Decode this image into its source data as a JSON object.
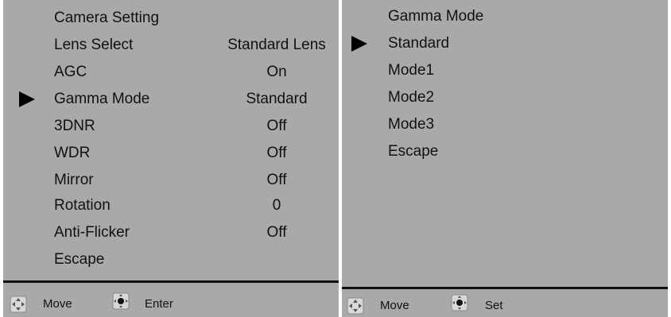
{
  "camera_menu": {
    "title": "Camera Setting",
    "items": [
      {
        "label": "Lens Select",
        "value": "Standard Lens"
      },
      {
        "label": "AGC",
        "value": "On"
      },
      {
        "label": "Gamma Mode",
        "value": "Standard",
        "selected": true
      },
      {
        "label": "3DNR",
        "value": "Off"
      },
      {
        "label": "WDR",
        "value": "Off"
      },
      {
        "label": "Mirror",
        "value": "Off"
      },
      {
        "label": "Rotation",
        "value": "0"
      },
      {
        "label": "Anti-Flicker",
        "value": "Off"
      },
      {
        "label": "Escape",
        "value": ""
      }
    ],
    "footer": {
      "move_label": "Move",
      "action_label": "Enter"
    }
  },
  "gamma_menu": {
    "title": "Gamma Mode",
    "items": [
      {
        "label": "Standard",
        "selected": true
      },
      {
        "label": "Mode1"
      },
      {
        "label": "Mode2"
      },
      {
        "label": "Mode3"
      },
      {
        "label": "Escape"
      }
    ],
    "footer": {
      "move_label": "Move",
      "action_label": "Set"
    }
  },
  "icons": {
    "move": "four-way-arrow-icon",
    "action": "joystick-press-icon",
    "cursor": "triangle-right-icon"
  },
  "colors": {
    "menu_background": "#a9a9a9",
    "text": "#111111"
  }
}
